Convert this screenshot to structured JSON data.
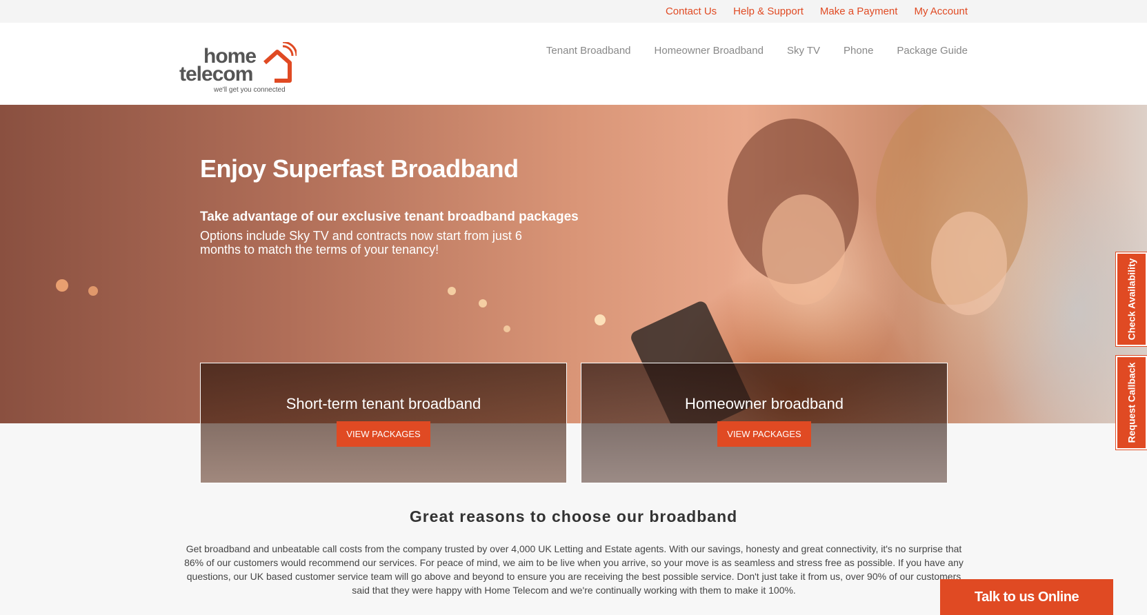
{
  "topbar": {
    "links": [
      "Contact Us",
      "Help & Support",
      "Make a Payment",
      "My Account"
    ]
  },
  "logo": {
    "line1": "home",
    "line2": "telecom",
    "tagline": "we'll get you connected"
  },
  "nav": {
    "items": [
      "Tenant Broadband",
      "Homeowner Broadband",
      "Sky TV",
      "Phone",
      "Package Guide"
    ]
  },
  "hero": {
    "title": "Enjoy Superfast Broadband",
    "subtitle": "Take advantage of our exclusive tenant broadband packages",
    "body": "Options include Sky TV and contracts now start from just 6 months to match the terms of your tenancy!"
  },
  "cards": [
    {
      "title": "Short-term tenant broadband",
      "button": "VIEW PACKAGES"
    },
    {
      "title": "Homeowner broadband",
      "button": "VIEW PACKAGES"
    }
  ],
  "reasons": {
    "title": "Great reasons to choose our broadband",
    "body": "Get broadband and unbeatable call costs from the company trusted by over 4,000 UK Letting and Estate agents. With our savings, honesty and great connectivity, it's no surprise that 86% of our customers would recommend our services. For peace of mind, we aim to be live when you arrive, so your move is as seamless and stress free as possible. If you have any questions, our UK based customer service team will go above and beyond to ensure you are receiving the best possible service. Don't just take it from us, over 90% of our customers said that they were happy with Home Telecom and we're continually working with them to make it 100%."
  },
  "side_tabs": {
    "availability": "Check Availability",
    "callback": "Request Callback"
  },
  "chat": {
    "label": "Talk to us Online"
  },
  "colors": {
    "accent": "#e04a23",
    "nav_text": "#888888"
  }
}
